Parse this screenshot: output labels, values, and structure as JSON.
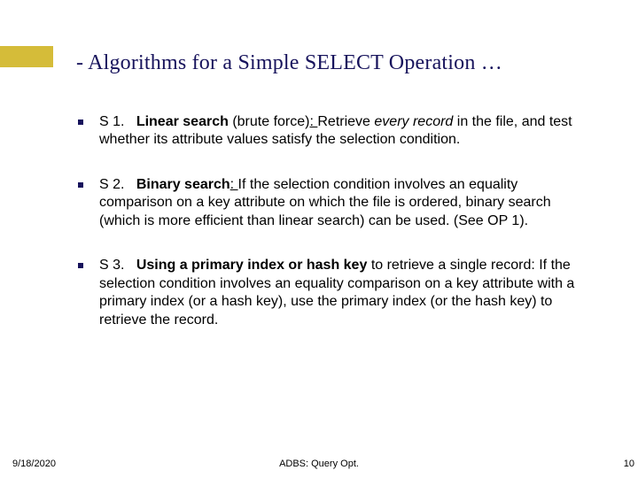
{
  "title": "- Algorithms for a Simple SELECT Operation …",
  "bullets": [
    {
      "label": "S 1.",
      "name_before": "",
      "name_strong": "Linear search",
      "name_after": " (brute force)",
      "colon": ": ",
      "body_before_em": "Retrieve ",
      "em": "every record",
      "body_after_em": " in the file, and test whether its attribute values satisfy the selection condition."
    },
    {
      "label": "S 2.",
      "name_before": "",
      "name_strong": "Binary search",
      "name_after": "",
      "colon": ": ",
      "body_before_em": "",
      "em": "",
      "body_after_em": "If the selection condition involves an equality comparison on a key attribute on which the file is ordered, binary search (which is more efficient than linear search) can be used. (See OP 1)."
    },
    {
      "label": "S 3.",
      "name_before": "",
      "name_strong": "Using a primary index or hash key",
      "name_after": "",
      "colon": " ",
      "body_before_em": "",
      "em": "",
      "body_after_em": "to retrieve a single record: If the selection condition involves an equality comparison on a key attribute with a primary index (or a hash key), use the primary index (or the hash key) to retrieve the record."
    }
  ],
  "footer": {
    "date": "9/18/2020",
    "center": "ADBS: Query Opt.",
    "page": "10"
  }
}
